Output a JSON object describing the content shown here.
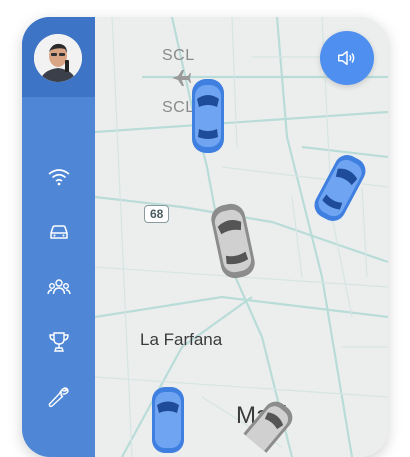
{
  "sidebar": {
    "items": [
      {
        "icon": "wifi-icon"
      },
      {
        "icon": "car-icon"
      },
      {
        "icon": "group-icon"
      },
      {
        "icon": "trophy-icon"
      },
      {
        "icon": "wrench-icon"
      }
    ]
  },
  "map": {
    "airport_label_top": "SCL",
    "airport_label_bottom": "SCL",
    "route_shield": "68",
    "place_label": "La Farfana",
    "city_label_partial": "Ma  ú"
  },
  "colors": {
    "sidebar": "#4f87d6",
    "sidebar_header": "#3e74c6",
    "accent": "#4f8ff0",
    "active_car": "#3f7fe0",
    "idle_car": "#9a9a9a"
  },
  "sound_button": {
    "icon": "speaker-icon"
  }
}
